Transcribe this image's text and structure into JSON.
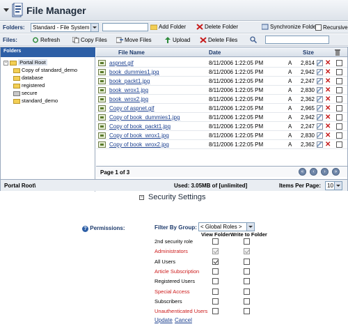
{
  "header": {
    "title": "File Manager"
  },
  "toolbar": {
    "folders_label": "Folders:",
    "folder_select_value": "Standard - File System",
    "add_folder": "Add Folder",
    "delete_folder": "Delete Folder",
    "synchronize_folder": "Synchronize Folder",
    "recursive": "Recursive",
    "files_label": "Files:",
    "refresh": "Refresh",
    "copy_files": "Copy Files",
    "move_files": "Move Files",
    "upload": "Upload",
    "delete_files": "Delete Files"
  },
  "folders": {
    "heading": "Folders",
    "root": "Portal Root",
    "items": [
      "Copy of standard_demo",
      "database",
      "registered",
      "secure",
      "standard_demo"
    ]
  },
  "files": {
    "columns": {
      "name": "File Name",
      "date": "Date",
      "size": "Size"
    },
    "rows": [
      {
        "name": "aspnet.gif",
        "date": "8/11/2006 1:22:05 PM",
        "attr": "A",
        "size": "2,814"
      },
      {
        "name": "book_dummies1.jpg",
        "date": "8/11/2006 1:22:05 PM",
        "attr": "A",
        "size": "2,942"
      },
      {
        "name": "book_packt1.jpg",
        "date": "8/11/2006 1:22:05 PM",
        "attr": "A",
        "size": "2,247"
      },
      {
        "name": "book_wrox1.jpg",
        "date": "8/11/2006 1:22:05 PM",
        "attr": "A",
        "size": "2,830"
      },
      {
        "name": "book_wrox2.jpg",
        "date": "8/11/2006 1:22:05 PM",
        "attr": "A",
        "size": "2,362"
      },
      {
        "name": "Copy of aspnet.gif",
        "date": "8/11/2006 1:22:05 PM",
        "attr": "A",
        "size": "2,965"
      },
      {
        "name": "Copy of book_dummies1.jpg",
        "date": "8/11/2006 1:22:05 PM",
        "attr": "A",
        "size": "2,942"
      },
      {
        "name": "Copy of book_packt1.jpg",
        "date": "8/11/2006 1:22:05 PM",
        "attr": "A",
        "size": "2,247"
      },
      {
        "name": "Copy of book_wrox1.jpg",
        "date": "8/11/2006 1:22:05 PM",
        "attr": "A",
        "size": "2,830"
      },
      {
        "name": "Copy of book_wrox2.jpg",
        "date": "8/11/2006 1:22:05 PM",
        "attr": "A",
        "size": "2,362"
      }
    ],
    "page_info": "Page 1 of 3"
  },
  "status": {
    "path": "Portal Root\\",
    "used": "Used: 3.05MB of [unlimited]",
    "items_per_page_label": "Items Per Page:",
    "items_per_page_value": "10"
  },
  "security": {
    "title": "Security Settings",
    "permissions_label": "Permissions:",
    "filter_label": "Filter By Group:",
    "filter_value": "< Global Roles >",
    "col_view": "View Folder",
    "col_write": "Write to Folder",
    "roles": [
      {
        "name": "2nd security role",
        "red": false,
        "view": false,
        "write": false,
        "disabled": false
      },
      {
        "name": "Administrators",
        "red": true,
        "view": true,
        "write": true,
        "disabled": true
      },
      {
        "name": "All Users",
        "red": false,
        "view": true,
        "write": false,
        "disabled": false
      },
      {
        "name": "Article Subscription",
        "red": true,
        "view": false,
        "write": false,
        "disabled": false
      },
      {
        "name": "Registered Users",
        "red": false,
        "view": false,
        "write": false,
        "disabled": false
      },
      {
        "name": "Special Access",
        "red": true,
        "view": false,
        "write": false,
        "disabled": false
      },
      {
        "name": "Subscribers",
        "red": false,
        "view": false,
        "write": false,
        "disabled": false
      },
      {
        "name": "Unauthenticated Users",
        "red": true,
        "view": false,
        "write": false,
        "disabled": false
      }
    ],
    "update": "Update",
    "cancel": "Cancel"
  },
  "colors": {
    "accent": "#2d5fa6",
    "link": "#1a3f8f",
    "role_red": "#cc1a1a"
  }
}
